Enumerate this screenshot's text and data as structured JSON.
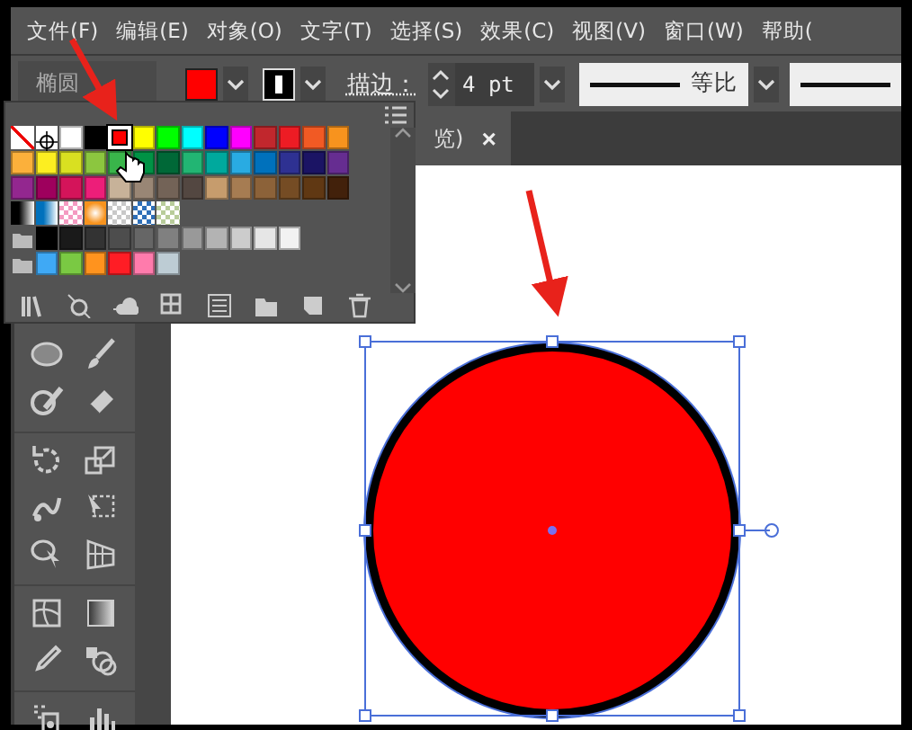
{
  "menu": [
    "文件(F)",
    "编辑(E)",
    "对象(O)",
    "文字(T)",
    "选择(S)",
    "效果(C)",
    "视图(V)",
    "窗口(W)",
    "帮助("
  ],
  "control_bar": {
    "object_type": "椭圆",
    "stroke_label": "描边：",
    "stroke_weight": "4 pt",
    "profile_label": "等比"
  },
  "swatches": {
    "rows": [
      {
        "group": false,
        "swatches": [
          {
            "kind": "none",
            "selected": false
          },
          {
            "kind": "registration",
            "selected": false
          },
          {
            "kind": "color",
            "color": "#ffffff",
            "selected": false
          },
          {
            "kind": "color",
            "color": "#000000",
            "selected": false
          },
          {
            "kind": "color",
            "color": "#ff0000",
            "selected": true
          },
          {
            "kind": "color",
            "color": "#ffff00",
            "selected": false
          },
          {
            "kind": "color",
            "color": "#00ff00",
            "selected": false
          },
          {
            "kind": "color",
            "color": "#00ffff",
            "selected": false
          },
          {
            "kind": "color",
            "color": "#0000ff",
            "selected": false
          },
          {
            "kind": "color",
            "color": "#ff00ff",
            "selected": false
          },
          {
            "kind": "color",
            "color": "#c1272d",
            "selected": false
          },
          {
            "kind": "color",
            "color": "#ed1c24",
            "selected": false
          },
          {
            "kind": "color",
            "color": "#f15a24",
            "selected": false
          },
          {
            "kind": "color",
            "color": "#f7931e",
            "selected": false
          }
        ]
      },
      {
        "group": false,
        "swatches": [
          {
            "kind": "color",
            "color": "#fbb03b",
            "selected": false
          },
          {
            "kind": "color",
            "color": "#fcee21",
            "selected": false
          },
          {
            "kind": "color",
            "color": "#d9e021",
            "selected": false
          },
          {
            "kind": "color",
            "color": "#8cc63f",
            "selected": false
          },
          {
            "kind": "color",
            "color": "#39b54a",
            "selected": false
          },
          {
            "kind": "color",
            "color": "#009245",
            "selected": false
          },
          {
            "kind": "color",
            "color": "#006837",
            "selected": false
          },
          {
            "kind": "color",
            "color": "#22b573",
            "selected": false
          },
          {
            "kind": "color",
            "color": "#00a99d",
            "selected": false
          },
          {
            "kind": "color",
            "color": "#29abe2",
            "selected": false
          },
          {
            "kind": "color",
            "color": "#0071bc",
            "selected": false
          },
          {
            "kind": "color",
            "color": "#2e3192",
            "selected": false
          },
          {
            "kind": "color",
            "color": "#1b1464",
            "selected": false
          },
          {
            "kind": "color",
            "color": "#662d91",
            "selected": false
          }
        ]
      },
      {
        "group": false,
        "swatches": [
          {
            "kind": "color",
            "color": "#93278f",
            "selected": false
          },
          {
            "kind": "color",
            "color": "#9e005d",
            "selected": false
          },
          {
            "kind": "color",
            "color": "#d4145a",
            "selected": false
          },
          {
            "kind": "color",
            "color": "#ed1e79",
            "selected": false
          },
          {
            "kind": "color",
            "color": "#c7b299",
            "selected": false
          },
          {
            "kind": "color",
            "color": "#998675",
            "selected": false
          },
          {
            "kind": "color",
            "color": "#736357",
            "selected": false
          },
          {
            "kind": "color",
            "color": "#534741",
            "selected": false
          },
          {
            "kind": "color",
            "color": "#c69c6d",
            "selected": false
          },
          {
            "kind": "color",
            "color": "#a67c52",
            "selected": false
          },
          {
            "kind": "color",
            "color": "#8c6239",
            "selected": false
          },
          {
            "kind": "color",
            "color": "#754c24",
            "selected": false
          },
          {
            "kind": "color",
            "color": "#603813",
            "selected": false
          },
          {
            "kind": "color",
            "color": "#42210b",
            "selected": false
          }
        ]
      },
      {
        "group": false,
        "swatches": [
          {
            "kind": "gradient",
            "color": "#000000",
            "selected": false
          },
          {
            "kind": "gradient",
            "color": "#0071bc",
            "selected": false
          },
          {
            "kind": "pattern",
            "color": "#f49ac1",
            "selected": false
          },
          {
            "kind": "gradient",
            "color": "#f7931e",
            "selected": false
          },
          {
            "kind": "pattern",
            "color": "#c8c8c8",
            "selected": false
          },
          {
            "kind": "pattern",
            "color": "#2e6fb8",
            "selected": false
          },
          {
            "kind": "pattern",
            "color": "#b8cc9a",
            "selected": false
          }
        ]
      },
      {
        "group": true,
        "swatches": [
          {
            "kind": "color",
            "color": "#000000",
            "selected": false
          },
          {
            "kind": "color",
            "color": "#1a1a1a",
            "selected": false
          },
          {
            "kind": "color",
            "color": "#333333",
            "selected": false
          },
          {
            "kind": "color",
            "color": "#4d4d4d",
            "selected": false
          },
          {
            "kind": "color",
            "color": "#666666",
            "selected": false
          },
          {
            "kind": "color",
            "color": "#808080",
            "selected": false
          },
          {
            "kind": "color",
            "color": "#999999",
            "selected": false
          },
          {
            "kind": "color",
            "color": "#b3b3b3",
            "selected": false
          },
          {
            "kind": "color",
            "color": "#cccccc",
            "selected": false
          },
          {
            "kind": "color",
            "color": "#e6e6e6",
            "selected": false
          },
          {
            "kind": "color",
            "color": "#f2f2f2",
            "selected": false
          }
        ]
      },
      {
        "group": true,
        "swatches": [
          {
            "kind": "color",
            "color": "#3fa9f5",
            "selected": false
          },
          {
            "kind": "color",
            "color": "#7ac943",
            "selected": false
          },
          {
            "kind": "color",
            "color": "#ff931e",
            "selected": false
          },
          {
            "kind": "color",
            "color": "#ff1d25",
            "selected": false
          },
          {
            "kind": "color",
            "color": "#ff7bac",
            "selected": false
          },
          {
            "kind": "color",
            "color": "#bdccd4",
            "selected": false
          }
        ]
      }
    ]
  },
  "document_tab": {
    "title": "览)",
    "close": "×"
  },
  "canvas": {
    "shape": {
      "kind": "ellipse",
      "selected": true
    }
  }
}
